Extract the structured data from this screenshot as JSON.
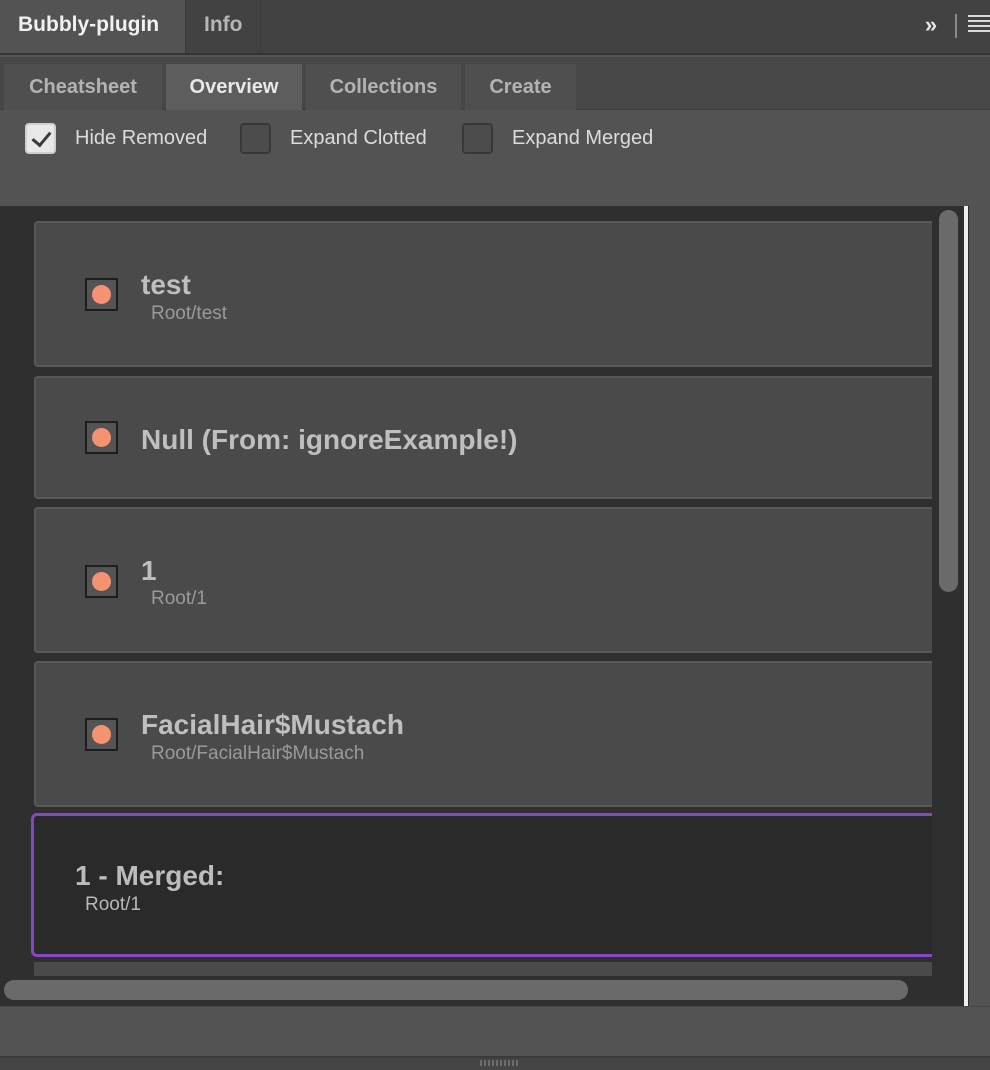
{
  "panel": {
    "tabs": [
      {
        "label": "Bubbly-plugin",
        "active": true
      },
      {
        "label": "Info",
        "active": false
      }
    ],
    "collapse_glyph": "»",
    "menu_icon": "hamburger-icon"
  },
  "subtabs": [
    {
      "label": "Cheatsheet",
      "active": false
    },
    {
      "label": "Overview",
      "active": true
    },
    {
      "label": "Collections",
      "active": false
    },
    {
      "label": "Create",
      "active": false
    }
  ],
  "options": [
    {
      "label": "Hide Removed",
      "checked": true
    },
    {
      "label": "Expand Clotted",
      "checked": false
    },
    {
      "label": "Expand Merged",
      "checked": false
    }
  ],
  "items": [
    {
      "title": "test",
      "path": "Root/test"
    },
    {
      "title": "Null (From: ignoreExample!)",
      "path": ""
    },
    {
      "title": "1",
      "path": "Root/1"
    },
    {
      "title": "FacialHair$Mustach",
      "path": "Root/FacialHair$Mustach"
    }
  ],
  "merged": {
    "title": "1 - Merged:",
    "path": "Root/1"
  },
  "colors": {
    "indicator": "#f59271",
    "merged_border": "#8547c3",
    "background": "#535353"
  }
}
